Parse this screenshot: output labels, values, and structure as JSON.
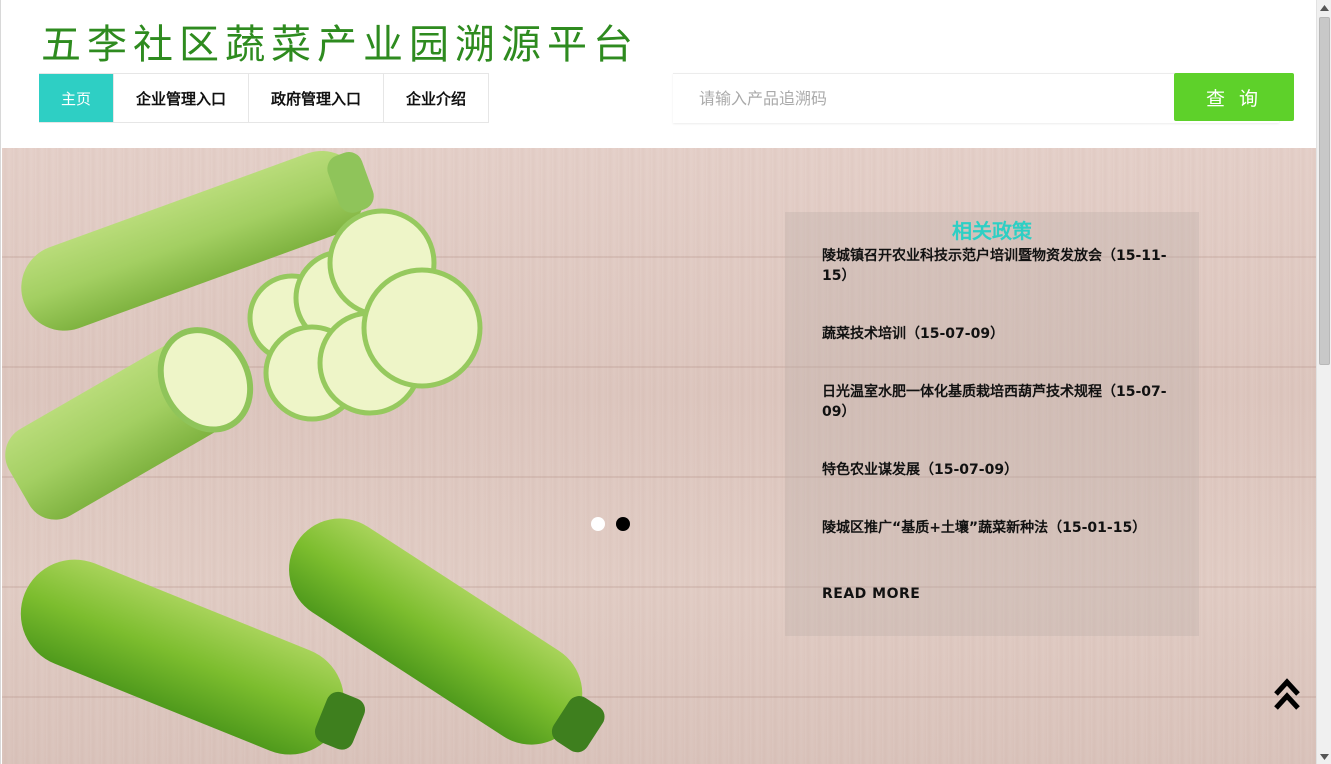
{
  "header": {
    "site_title": "五李社区蔬菜产业园溯源平台"
  },
  "nav": {
    "items": [
      {
        "label": "主页",
        "active": true
      },
      {
        "label": "企业管理入口",
        "active": false
      },
      {
        "label": "政府管理入口",
        "active": false
      },
      {
        "label": "企业介绍",
        "active": false
      }
    ]
  },
  "search": {
    "placeholder": "请输入产品追溯码",
    "value": "",
    "button_label": "查 询"
  },
  "hero": {
    "carousel": {
      "slide_count": 2,
      "active_index": 1
    }
  },
  "policy": {
    "heading": "相关政策",
    "items": [
      "陵城镇召开农业科技示范户培训暨物资发放会（15-11-15）",
      "蔬菜技术培训（15-07-09）",
      "日光温室水肥一体化基质栽培西葫芦技术规程（15-07-09）",
      "特色农业谋发展（15-07-09）",
      "陵城区推广“基质+土壤”蔬菜新种法（15-01-15）"
    ],
    "read_more": "READ MORE"
  },
  "icons": {
    "back_to_top": "double-chevron-up-icon",
    "scroll_up": "scroll-up-arrow-icon",
    "scroll_down": "scroll-down-arrow-icon"
  },
  "colors": {
    "title_green": "#2e8b1f",
    "nav_active": "#2ecfc4",
    "search_button": "#5ed12a",
    "policy_heading": "#2ecfc4"
  }
}
